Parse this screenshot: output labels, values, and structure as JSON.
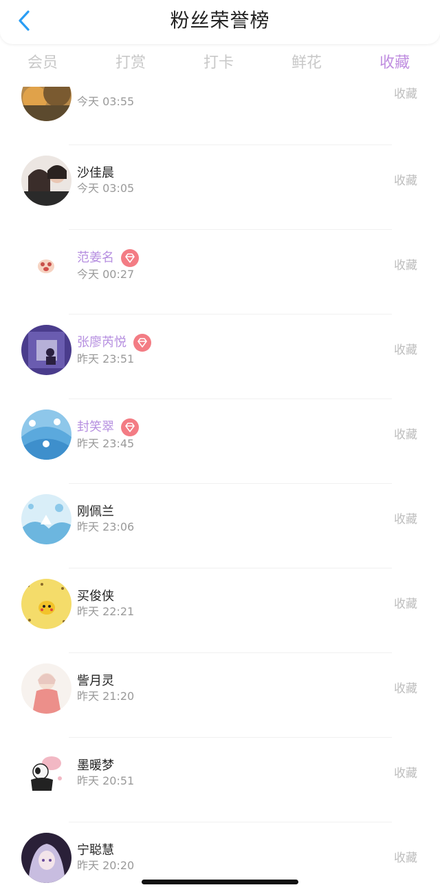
{
  "header": {
    "title": "粉丝荣誉榜"
  },
  "tabs": [
    {
      "label": "会员"
    },
    {
      "label": "打赏"
    },
    {
      "label": "打卡"
    },
    {
      "label": "鲜花"
    },
    {
      "label": "收藏",
      "active": true
    }
  ],
  "list": {
    "action_label": "收藏",
    "items": [
      {
        "name": "",
        "time": "今天 03:55",
        "vip": false
      },
      {
        "name": "沙佳晨",
        "time": "今天 03:05",
        "vip": false
      },
      {
        "name": "范姜名",
        "time": "今天 00:27",
        "vip": true
      },
      {
        "name": "张廖芮悦",
        "time": "昨天 23:51",
        "vip": true
      },
      {
        "name": "封笑翠",
        "time": "昨天 23:45",
        "vip": true
      },
      {
        "name": "刚佩兰",
        "time": "昨天 23:06",
        "vip": false
      },
      {
        "name": "买俊侠",
        "time": "昨天 22:21",
        "vip": false
      },
      {
        "name": "訾月灵",
        "time": "昨天 21:20",
        "vip": false
      },
      {
        "name": "墨暖梦",
        "time": "昨天 20:51",
        "vip": false
      },
      {
        "name": "宁聪慧",
        "time": "昨天 20:20",
        "vip": false
      }
    ]
  },
  "colors": {
    "accent": "#c08ee0",
    "vip_name": "#b68fe0",
    "badge": "#f37c84",
    "back": "#2a9df4"
  }
}
